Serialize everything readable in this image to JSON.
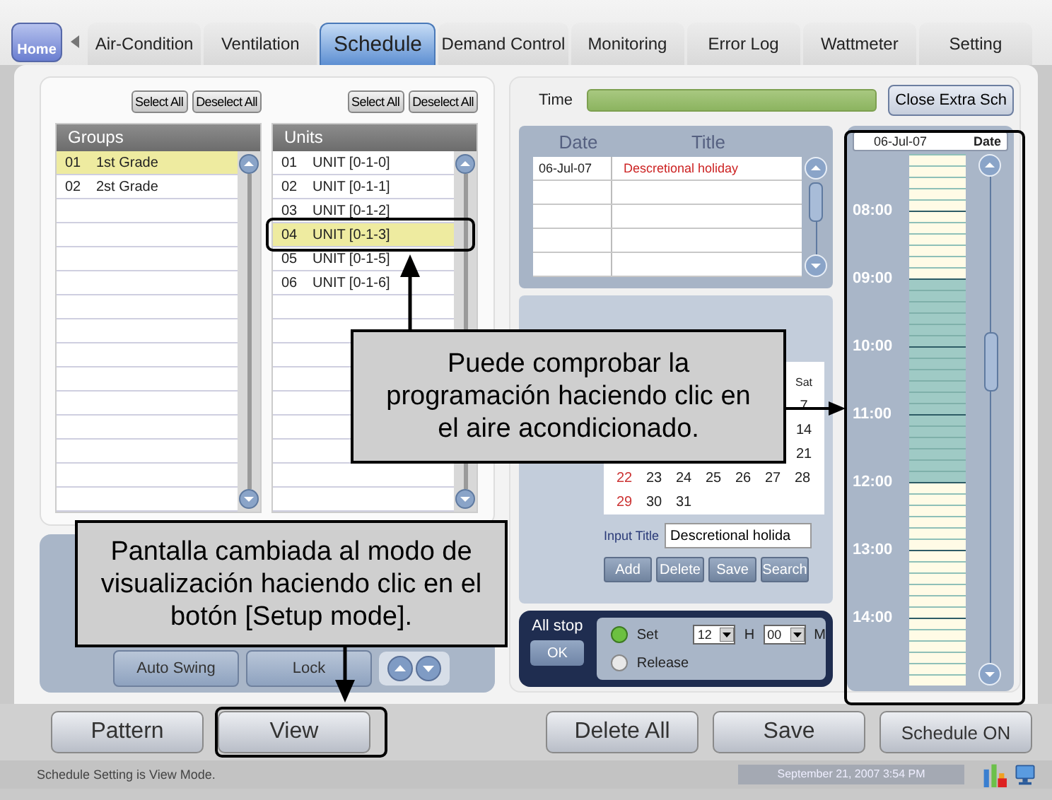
{
  "home_button": "Home",
  "tabs": [
    {
      "label": "Air-Condition",
      "selected": false
    },
    {
      "label": "Ventilation",
      "selected": false
    },
    {
      "label": "Schedule",
      "selected": true
    },
    {
      "label": "Demand Control",
      "selected": false
    },
    {
      "label": "Monitoring",
      "selected": false
    },
    {
      "label": "Error Log",
      "selected": false
    },
    {
      "label": "Wattmeter",
      "selected": false
    },
    {
      "label": "Setting",
      "selected": false
    }
  ],
  "lists": [
    {
      "select_all": "Select All",
      "deselect_all": "Deselect All",
      "header": "Groups",
      "rows": [
        {
          "no": "01",
          "name": "1st Grade",
          "selected": true
        },
        {
          "no": "02",
          "name": "2st Grade",
          "selected": false
        }
      ]
    },
    {
      "select_all": "Select All",
      "deselect_all": "Deselect All",
      "header": "Units",
      "rows": [
        {
          "no": "01",
          "name": "UNIT [0-1-0]",
          "selected": false
        },
        {
          "no": "02",
          "name": "UNIT [0-1-1]",
          "selected": false
        },
        {
          "no": "03",
          "name": "UNIT [0-1-2]",
          "selected": false
        },
        {
          "no": "04",
          "name": "UNIT [0-1-3]",
          "selected": true
        },
        {
          "no": "05",
          "name": "UNIT [0-1-5]",
          "selected": false
        },
        {
          "no": "06",
          "name": "UNIT [0-1-6]",
          "selected": false
        }
      ]
    }
  ],
  "control_buttons": [
    "Auto Swing",
    "Lock"
  ],
  "time": {
    "label": "Time"
  },
  "close_button": "Close Extra Sch",
  "holidays": {
    "columns": [
      "Date",
      "Title"
    ],
    "rows": [
      {
        "date": "06-Jul-07",
        "title": "Descretional holiday"
      }
    ]
  },
  "calendar": {
    "weekday": "Sat",
    "weeks": [
      {
        "days": [
          "7"
        ]
      },
      {
        "days": [
          "14"
        ]
      },
      {
        "days": [
          "21"
        ]
      },
      {
        "days": [
          "22",
          "23",
          "24",
          "25",
          "26",
          "27",
          "28"
        ]
      },
      {
        "days": [
          "29",
          "30",
          "31"
        ]
      }
    ]
  },
  "input_title": {
    "label": "Input Title",
    "value": "Descretional holida"
  },
  "calendar_buttons": [
    "Add",
    "Delete",
    "Save",
    "Search"
  ],
  "all_stop": {
    "label": "All stop",
    "ok": "OK",
    "hour": "12",
    "hour_unit": "H",
    "minute": "00",
    "minute_unit": "M",
    "options": [
      {
        "label": "Set",
        "selected": true
      },
      {
        "label": "Release",
        "selected": false
      }
    ]
  },
  "timeline": {
    "date": "06-Jul-07",
    "date_label": "Date",
    "blocks": [
      {
        "slots": [
          {
            "scheduled": false
          },
          {
            "scheduled": false
          },
          {
            "scheduled": false
          },
          {
            "scheduled": false
          },
          {
            "scheduled": false
          }
        ]
      },
      {
        "time": "08:00",
        "slots": [
          {
            "scheduled": false
          },
          {
            "scheduled": false
          },
          {
            "scheduled": false
          },
          {
            "scheduled": false
          },
          {
            "scheduled": false
          },
          {
            "scheduled": false
          }
        ]
      },
      {
        "time": "09:00",
        "slots": [
          {
            "scheduled": true
          },
          {
            "scheduled": true
          },
          {
            "scheduled": true
          },
          {
            "scheduled": true
          },
          {
            "scheduled": true
          },
          {
            "scheduled": true
          }
        ]
      },
      {
        "time": "10:00",
        "slots": [
          {
            "scheduled": true
          },
          {
            "scheduled": true
          },
          {
            "scheduled": true
          },
          {
            "scheduled": true
          },
          {
            "scheduled": true
          },
          {
            "scheduled": true
          }
        ]
      },
      {
        "time": "11:00",
        "slots": [
          {
            "scheduled": true
          },
          {
            "scheduled": true
          },
          {
            "scheduled": true
          },
          {
            "scheduled": true
          },
          {
            "scheduled": true
          },
          {
            "scheduled": true
          }
        ]
      },
      {
        "time": "12:00",
        "slots": [
          {
            "scheduled": false
          },
          {
            "scheduled": false
          },
          {
            "scheduled": false
          },
          {
            "scheduled": false
          },
          {
            "scheduled": false
          },
          {
            "scheduled": false
          }
        ]
      },
      {
        "time": "13:00",
        "slots": [
          {
            "scheduled": false
          },
          {
            "scheduled": false
          },
          {
            "scheduled": false
          },
          {
            "scheduled": false
          },
          {
            "scheduled": false
          },
          {
            "scheduled": false
          }
        ]
      },
      {
        "time": "14:00",
        "slots": [
          {
            "scheduled": false
          },
          {
            "scheduled": false
          },
          {
            "scheduled": false
          },
          {
            "scheduled": false
          },
          {
            "scheduled": false
          },
          {
            "scheduled": false
          }
        ]
      }
    ]
  },
  "bottom_buttons": [
    "Pattern",
    "View",
    "Delete All",
    "Save",
    "Schedule ON"
  ],
  "status": {
    "message": "Schedule Setting is View Mode.",
    "datetime": "September 21, 2007 3:54 PM"
  },
  "callouts": [
    {
      "text": "Puede comprobar la programación haciendo clic en el aire acondicionado."
    },
    {
      "text": "Pantalla cambiada al modo de visualización haciendo clic en el botón [Setup mode]."
    }
  ]
}
